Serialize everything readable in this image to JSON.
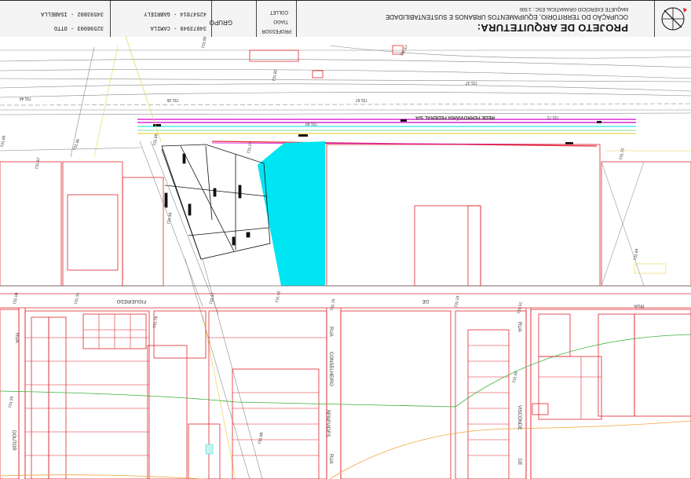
{
  "title_block": {
    "north_arrow": "north-arrow-icon",
    "title": "PROJETO DE ARQUITETURA:",
    "subtitle": "OCUPAÇÃO DO TERRITÓRIO, EQUIPAMENTOS URBANOS E SUSTENTABILIDADE",
    "scale_note": "MAQUETE EXERCÍCIO GRAMATICAL  ESC.: 1:500",
    "professor_label": "PROFESSOR",
    "professor_name_1": "TIAGO",
    "professor_name_2": "COLLET",
    "group_label": "GRUPO",
    "members": [
      "34073949  -  CAMILA",
      "42547814  -  GABRIELY",
      "32598003  -  OTTO",
      "34593802  -  ISABELLA"
    ]
  },
  "map": {
    "railway_label": "REDE FERROVIÁRIA FEDERAL S/A",
    "street_labels": [
      "RUA",
      "FIGUEIREDO",
      "DE",
      "RUA",
      "CONSELHEIRO",
      "BENEVIDES",
      "RUA",
      "RUA",
      "VISCONDE",
      "DE",
      "RUA",
      "DOUTOR"
    ],
    "elevation_labels": [
      "731.40",
      "731.36",
      "731.82",
      "731.67",
      "731.37",
      "731.71",
      "731.82",
      "731.90",
      "731.57",
      "731.85",
      "731.96",
      "731.67",
      "731.69",
      "731.27",
      "731.72",
      "731.84",
      "731.46",
      "731.06",
      "731.31",
      "731.17",
      "731.42",
      "731.75",
      "731.23",
      "731.51",
      "731.78",
      "731.62",
      "731.55",
      "731.88"
    ],
    "colors": {
      "lots": "#e0262b",
      "site_fill": "#00e5f2",
      "curb": "#9a9a9a",
      "rail": "#8a8a8a",
      "track_magenta": "#d400d4",
      "track_cyan": "#2ee6e6",
      "contour_green": "#3cae3c",
      "contour_orange": "#f0a640",
      "highlight_yellow": "#e6d450"
    }
  }
}
